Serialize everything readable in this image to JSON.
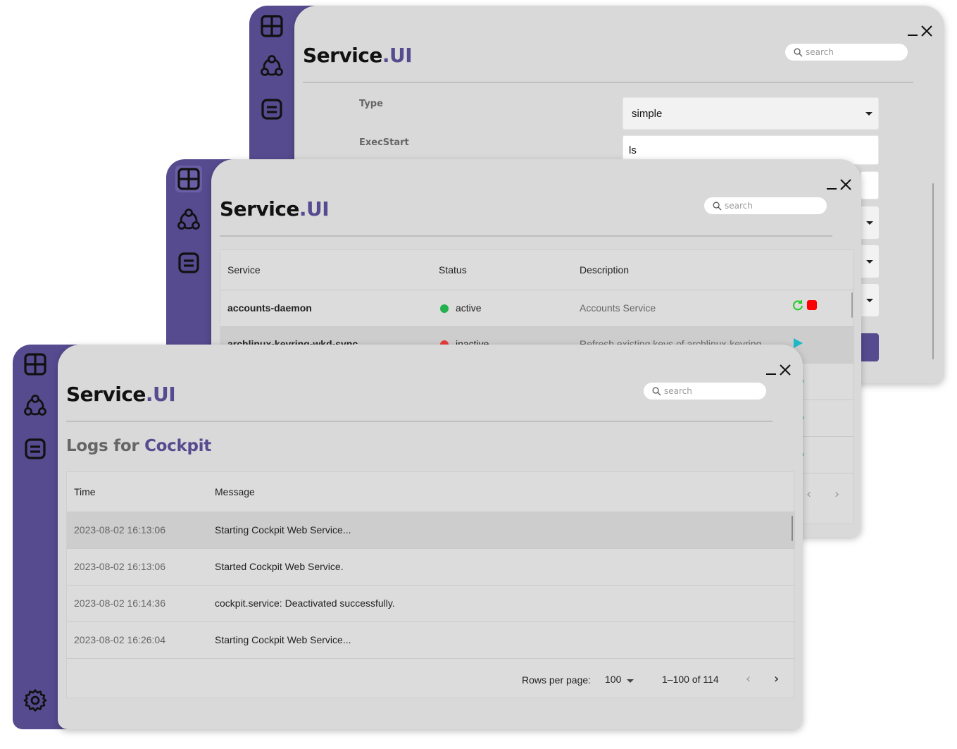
{
  "brand": {
    "name": "Service",
    "accent": ".UI"
  },
  "search": {
    "placeholder": "search"
  },
  "colors": {
    "sidebar": "#574b90",
    "panel": "#d9d9d9",
    "active_status": "#22b14c",
    "inactive_status": "#e83a3a",
    "stop_button": "#ff0000",
    "restart_icon": "#22cc22"
  },
  "sidebar_icons": [
    "grid-icon",
    "network-icon",
    "list-icon",
    "gear-icon"
  ],
  "unit_editor": {
    "fields": [
      {
        "label": "Type",
        "value": "simple"
      },
      {
        "label": "ExecStart",
        "value": "ls"
      }
    ]
  },
  "services": {
    "columns": [
      "Service",
      "Status",
      "Description"
    ],
    "rows": [
      {
        "name": "accounts-daemon",
        "status": "active",
        "description": "Accounts Service"
      },
      {
        "name": "archlinux-keyring-wkd-sync",
        "status": "inactive",
        "description": "Refresh existing keys of archlinux-keyring"
      }
    ]
  },
  "logs": {
    "title_prefix": "Logs for ",
    "unit": "Cockpit",
    "columns": [
      "Time",
      "Message"
    ],
    "rows": [
      {
        "time": "2023-08-02 16:13:06",
        "message": "Starting Cockpit Web Service..."
      },
      {
        "time": "2023-08-02 16:13:06",
        "message": "Started Cockpit Web Service."
      },
      {
        "time": "2023-08-02 16:14:36",
        "message": "cockpit.service: Deactivated successfully."
      },
      {
        "time": "2023-08-02 16:26:04",
        "message": "Starting Cockpit Web Service..."
      }
    ],
    "pagination": {
      "rows_per_page_label": "Rows per page:",
      "rows_per_page": "100",
      "range": "1–100 of 114"
    }
  }
}
